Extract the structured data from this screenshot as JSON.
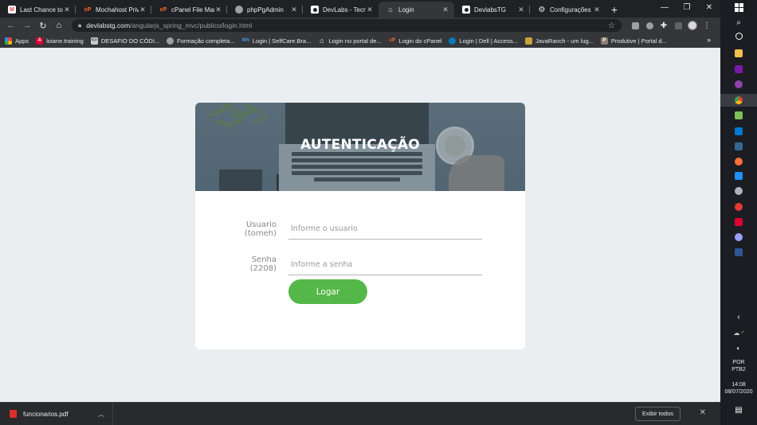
{
  "browser": {
    "tabs": [
      {
        "label": "Last Chance to R",
        "icon": "gmail-icon",
        "color": "#ea4335",
        "active": false
      },
      {
        "label": "Mochahost Priva",
        "icon": "cpanel-icon",
        "color": "#ff6c2c",
        "active": false
      },
      {
        "label": "cPanel File Mana",
        "icon": "cpanel-icon",
        "color": "#ff6c2c",
        "active": false
      },
      {
        "label": "phpPgAdmin",
        "icon": "elephant-icon",
        "color": "#9aa0a6",
        "active": false
      },
      {
        "label": "DevLabs - Tecno",
        "icon": "devlabs-icon",
        "color": "#ffffff",
        "active": false
      },
      {
        "label": "Login",
        "icon": "home-icon",
        "color": "#e8eaed",
        "active": true
      },
      {
        "label": "DevlabsTG",
        "icon": "devlabs-icon",
        "color": "#ffffff",
        "active": false
      },
      {
        "label": "Configurações",
        "icon": "gear-icon",
        "color": "#e8eaed",
        "active": false
      }
    ],
    "url_host": "devlabstg.com",
    "url_path": "/angularjs_spring_mvc/publico/login.html",
    "bookmarks": [
      {
        "label": "Apps",
        "icon": "apps-icon",
        "color": "#ea4335"
      },
      {
        "label": "loiane.training",
        "icon": "angular-icon",
        "color": "#dd0031"
      },
      {
        "label": "DESAFIO DO CÓDI...",
        "icon": "bookmark-icon",
        "color": "#cccccc"
      },
      {
        "label": "Formação completa...",
        "icon": "globe-icon",
        "color": "#9aa0a6"
      },
      {
        "label": "Login | SelfCare.Bra...",
        "icon": "bookmark-icon",
        "color": "#4a90d9"
      },
      {
        "label": "Login no portal de...",
        "icon": "home-icon",
        "color": "#e8eaed"
      },
      {
        "label": "Login do cPanel",
        "icon": "cpanel-icon",
        "color": "#ff6c2c"
      },
      {
        "label": "Login | Dell | Access...",
        "icon": "dell-icon",
        "color": "#007db8"
      },
      {
        "label": "JavaRanch - um lug...",
        "icon": "java-icon",
        "color": "#c8a53c"
      },
      {
        "label": "Produtive | Portal d...",
        "icon": "bookmark-icon",
        "color": "#8a7f70"
      }
    ]
  },
  "login": {
    "title": "AUTENTICAÇÃO",
    "user_label_1": "Usuario",
    "user_label_2": "(tomeh)",
    "user_placeholder": "Informe o usuario",
    "pass_label_1": "Senha",
    "pass_label_2": "(2208)",
    "pass_placeholder": "Informe a senha",
    "submit": "Logar",
    "button_color": "#54b848"
  },
  "downloads": {
    "file": "funcionarios.pdf",
    "show_all": "Exibir todos"
  },
  "taskbar": {
    "lang_1": "POR",
    "lang_2": "PTB2",
    "time": "14:08",
    "date": "08/07/2020"
  }
}
